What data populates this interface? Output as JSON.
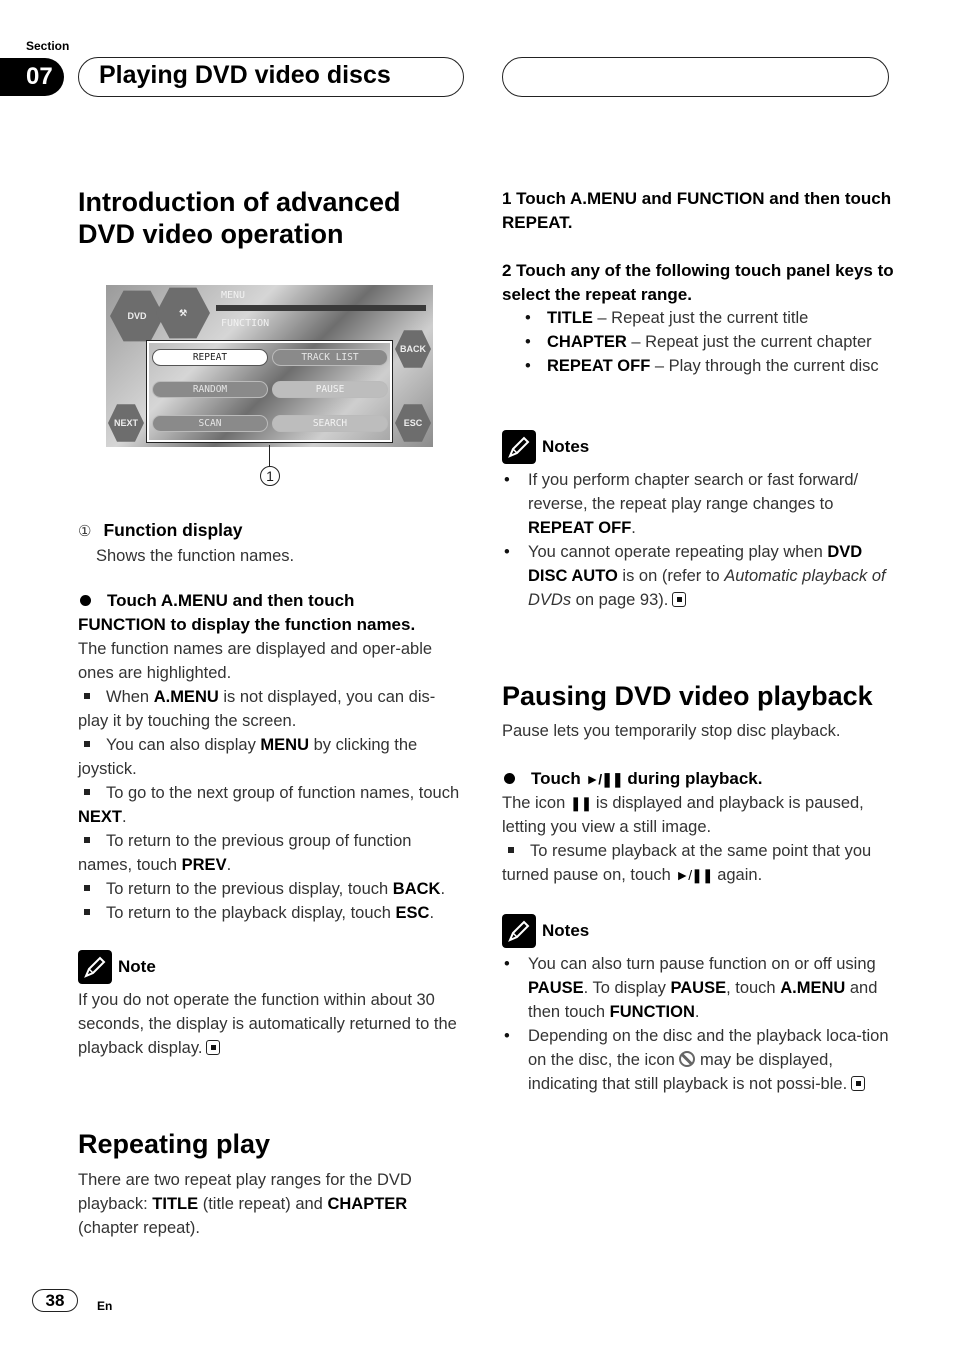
{
  "header": {
    "section_label": "Section",
    "section_number": "07",
    "chapter_title": "Playing DVD video discs"
  },
  "intro": {
    "heading_line1": "Introduction of advanced",
    "heading_line2": "DVD video operation",
    "figure": {
      "menu_label": "MENU",
      "function_label": "FUNCTION",
      "dvd_logo": "DVD",
      "keys": [
        "REPEAT",
        "TRACK LIST",
        "RANDOM",
        "PAUSE",
        "SCAN",
        "SEARCH"
      ],
      "side_keys": {
        "back": "BACK",
        "next": "NEXT",
        "esc": "ESC"
      },
      "callout": "1"
    },
    "callout_item": {
      "num": "①",
      "title": "Function display",
      "desc": "Shows the function names."
    },
    "instruction": {
      "line1": "Touch A.MENU and then touch",
      "line2": "FUNCTION to display the function names.",
      "desc": "The function names are displayed and oper-able ones are highlighted."
    },
    "tips": [
      {
        "pre": "When ",
        "bold": "A.MENU",
        "post": " is not displayed, you can dis-play it by touching the screen."
      },
      {
        "pre": "You can also display ",
        "bold": "MENU",
        "post": " by clicking the joystick."
      },
      {
        "pre": "To go to the next group of function names, touch ",
        "bold": "NEXT",
        "post": "."
      },
      {
        "pre": "To return to the previous group of function names, touch ",
        "bold": "PREV",
        "post": "."
      },
      {
        "pre": "To return to the previous display, touch ",
        "bold": "BACK",
        "post": "."
      },
      {
        "pre": "To return to the playback display, touch ",
        "bold": "ESC",
        "post": "."
      }
    ],
    "note": {
      "title": "Note",
      "text": "If you do not operate the function within about 30 seconds, the display is automatically returned to the playback display."
    }
  },
  "repeating": {
    "heading": "Repeating play",
    "p_pre": "There are two repeat play ranges for the DVD playback: ",
    "p_b1": "TITLE",
    "p_mid": " (title repeat) and ",
    "p_b2": "CHAPTER",
    "p_post": " (chapter repeat).",
    "step1": "1    Touch A.MENU and FUNCTION and then touch REPEAT.",
    "step2": "2    Touch any of the following touch panel keys to select the repeat range.",
    "options": [
      {
        "key": "TITLE",
        "desc": " – Repeat just the current title"
      },
      {
        "key": "CHAPTER",
        "desc": " – Repeat just the current chapter"
      },
      {
        "key": "REPEAT OFF",
        "desc": " – Play through the current disc"
      }
    ],
    "notes": {
      "title": "Notes",
      "n1_pre": "If you perform chapter search or fast forward/ reverse, the repeat play range changes to ",
      "n1_bold": "REPEAT OFF",
      "n1_post": ".",
      "n2_bold": "DVD DISC AUTO",
      "n2_pre": "You cannot operate repeating play when ",
      "n2_mid": " is on (refer to ",
      "n2_italic": "Automatic playback of DVDs",
      "n2_post": " on page 93)."
    }
  },
  "pausing": {
    "heading": "Pausing DVD video playback",
    "intro": "Pause lets you temporarily stop disc playback.",
    "instr_pre": "Touch ",
    "instr_glyph": "►/❚❚",
    "instr_post": " during playback.",
    "desc_pre": "The icon ",
    "desc_glyph": "❚❚",
    "desc_post": " is displayed and playback is paused, letting you view a still image.",
    "tip_pre": "To resume playback at the same point that you turned pause on, touch ",
    "tip_glyph": "►/❚❚",
    "tip_post": " again.",
    "notes": {
      "title": "Notes",
      "n1_a": "You can also turn pause function on or off using ",
      "n1_b": "PAUSE",
      "n1_c": ". To display ",
      "n1_d": "PAUSE",
      "n1_e": ", touch ",
      "n1_f": "A.MENU",
      "n1_g": " and then touch ",
      "n1_h": "FUNCTION",
      "n1_i": ".",
      "n2_pre": "Depending on the disc and the playback loca-tion on the disc, the icon ",
      "n2_post": " may be displayed, indicating that still playback is not possi-ble."
    }
  },
  "footer": {
    "page_number": "38",
    "language": "En"
  }
}
